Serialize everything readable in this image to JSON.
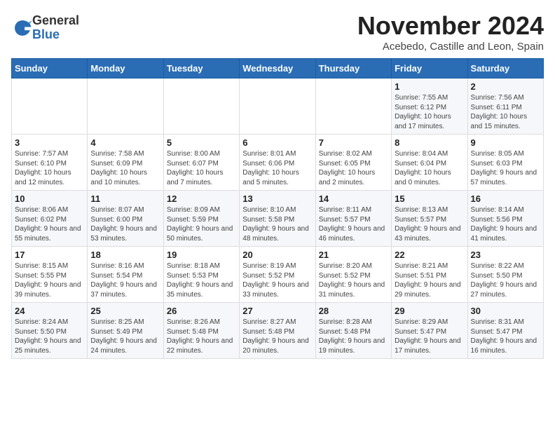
{
  "logo": {
    "general": "General",
    "blue": "Blue"
  },
  "title": "November 2024",
  "location": "Acebedo, Castille and Leon, Spain",
  "weekdays": [
    "Sunday",
    "Monday",
    "Tuesday",
    "Wednesday",
    "Thursday",
    "Friday",
    "Saturday"
  ],
  "weeks": [
    [
      {
        "day": "",
        "info": ""
      },
      {
        "day": "",
        "info": ""
      },
      {
        "day": "",
        "info": ""
      },
      {
        "day": "",
        "info": ""
      },
      {
        "day": "",
        "info": ""
      },
      {
        "day": "1",
        "info": "Sunrise: 7:55 AM\nSunset: 6:12 PM\nDaylight: 10 hours and 17 minutes."
      },
      {
        "day": "2",
        "info": "Sunrise: 7:56 AM\nSunset: 6:11 PM\nDaylight: 10 hours and 15 minutes."
      }
    ],
    [
      {
        "day": "3",
        "info": "Sunrise: 7:57 AM\nSunset: 6:10 PM\nDaylight: 10 hours and 12 minutes."
      },
      {
        "day": "4",
        "info": "Sunrise: 7:58 AM\nSunset: 6:09 PM\nDaylight: 10 hours and 10 minutes."
      },
      {
        "day": "5",
        "info": "Sunrise: 8:00 AM\nSunset: 6:07 PM\nDaylight: 10 hours and 7 minutes."
      },
      {
        "day": "6",
        "info": "Sunrise: 8:01 AM\nSunset: 6:06 PM\nDaylight: 10 hours and 5 minutes."
      },
      {
        "day": "7",
        "info": "Sunrise: 8:02 AM\nSunset: 6:05 PM\nDaylight: 10 hours and 2 minutes."
      },
      {
        "day": "8",
        "info": "Sunrise: 8:04 AM\nSunset: 6:04 PM\nDaylight: 10 hours and 0 minutes."
      },
      {
        "day": "9",
        "info": "Sunrise: 8:05 AM\nSunset: 6:03 PM\nDaylight: 9 hours and 57 minutes."
      }
    ],
    [
      {
        "day": "10",
        "info": "Sunrise: 8:06 AM\nSunset: 6:02 PM\nDaylight: 9 hours and 55 minutes."
      },
      {
        "day": "11",
        "info": "Sunrise: 8:07 AM\nSunset: 6:00 PM\nDaylight: 9 hours and 53 minutes."
      },
      {
        "day": "12",
        "info": "Sunrise: 8:09 AM\nSunset: 5:59 PM\nDaylight: 9 hours and 50 minutes."
      },
      {
        "day": "13",
        "info": "Sunrise: 8:10 AM\nSunset: 5:58 PM\nDaylight: 9 hours and 48 minutes."
      },
      {
        "day": "14",
        "info": "Sunrise: 8:11 AM\nSunset: 5:57 PM\nDaylight: 9 hours and 46 minutes."
      },
      {
        "day": "15",
        "info": "Sunrise: 8:13 AM\nSunset: 5:57 PM\nDaylight: 9 hours and 43 minutes."
      },
      {
        "day": "16",
        "info": "Sunrise: 8:14 AM\nSunset: 5:56 PM\nDaylight: 9 hours and 41 minutes."
      }
    ],
    [
      {
        "day": "17",
        "info": "Sunrise: 8:15 AM\nSunset: 5:55 PM\nDaylight: 9 hours and 39 minutes."
      },
      {
        "day": "18",
        "info": "Sunrise: 8:16 AM\nSunset: 5:54 PM\nDaylight: 9 hours and 37 minutes."
      },
      {
        "day": "19",
        "info": "Sunrise: 8:18 AM\nSunset: 5:53 PM\nDaylight: 9 hours and 35 minutes."
      },
      {
        "day": "20",
        "info": "Sunrise: 8:19 AM\nSunset: 5:52 PM\nDaylight: 9 hours and 33 minutes."
      },
      {
        "day": "21",
        "info": "Sunrise: 8:20 AM\nSunset: 5:52 PM\nDaylight: 9 hours and 31 minutes."
      },
      {
        "day": "22",
        "info": "Sunrise: 8:21 AM\nSunset: 5:51 PM\nDaylight: 9 hours and 29 minutes."
      },
      {
        "day": "23",
        "info": "Sunrise: 8:22 AM\nSunset: 5:50 PM\nDaylight: 9 hours and 27 minutes."
      }
    ],
    [
      {
        "day": "24",
        "info": "Sunrise: 8:24 AM\nSunset: 5:50 PM\nDaylight: 9 hours and 25 minutes."
      },
      {
        "day": "25",
        "info": "Sunrise: 8:25 AM\nSunset: 5:49 PM\nDaylight: 9 hours and 24 minutes."
      },
      {
        "day": "26",
        "info": "Sunrise: 8:26 AM\nSunset: 5:48 PM\nDaylight: 9 hours and 22 minutes."
      },
      {
        "day": "27",
        "info": "Sunrise: 8:27 AM\nSunset: 5:48 PM\nDaylight: 9 hours and 20 minutes."
      },
      {
        "day": "28",
        "info": "Sunrise: 8:28 AM\nSunset: 5:48 PM\nDaylight: 9 hours and 19 minutes."
      },
      {
        "day": "29",
        "info": "Sunrise: 8:29 AM\nSunset: 5:47 PM\nDaylight: 9 hours and 17 minutes."
      },
      {
        "day": "30",
        "info": "Sunrise: 8:31 AM\nSunset: 5:47 PM\nDaylight: 9 hours and 16 minutes."
      }
    ]
  ]
}
